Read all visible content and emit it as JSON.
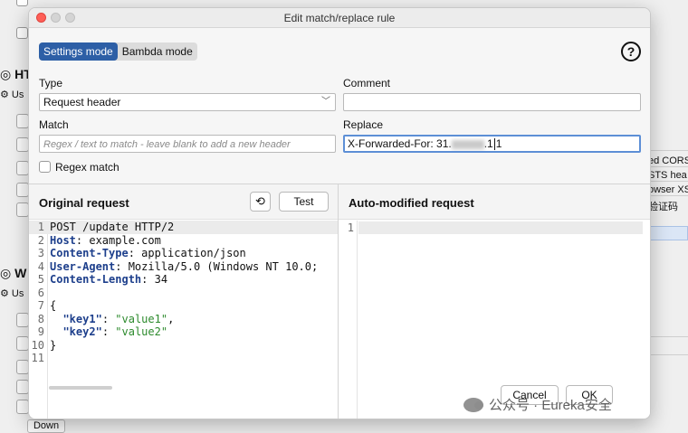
{
  "background": {
    "section1_title": "HT",
    "section1_sub": "Us",
    "section2_title": "W",
    "section2_sub": "Us",
    "right_texts": [
      "ed CORS",
      "STS hea",
      "owser XS",
      "验证码"
    ],
    "down_button": "Down"
  },
  "dialog": {
    "title": "Edit match/replace rule",
    "modes": [
      "Settings mode",
      "Bambda mode"
    ],
    "active_mode": "Settings mode",
    "help_symbol": "?",
    "type": {
      "label": "Type",
      "value": "Request header"
    },
    "comment": {
      "label": "Comment",
      "value": ""
    },
    "match": {
      "label": "Match",
      "placeholder": "Regex / text to match - leave blank to add a new header"
    },
    "replace": {
      "label": "Replace",
      "value_prefix": "X-Forwarded-For: 31.",
      "value_suffix": ".1"
    },
    "regex_match": {
      "label": "Regex match",
      "checked": false
    }
  },
  "original_request": {
    "title": "Original request",
    "test_label": "Test",
    "line_numbers": [
      "1",
      "2",
      "3",
      "4",
      "5",
      "6",
      "7",
      "8",
      "9",
      "10",
      "11"
    ],
    "request_line": "POST /update HTTP/2",
    "headers": [
      {
        "name": "Host",
        "value": ": example.com"
      },
      {
        "name": "Content-Type",
        "value": ": application/json"
      },
      {
        "name": "User-Agent",
        "value": ": Mozilla/5.0 (Windows NT 10.0;"
      },
      {
        "name": "Content-Length",
        "value": ": 34"
      }
    ],
    "body_open": "{",
    "body": [
      {
        "key": "\"key1\"",
        "sep": ": ",
        "value": "\"value1\"",
        "end": ","
      },
      {
        "key": "\"key2\"",
        "sep": ": ",
        "value": "\"value2\"",
        "end": ""
      }
    ],
    "body_close": "}"
  },
  "modified_request": {
    "title": "Auto-modified request",
    "line_numbers": [
      "1"
    ]
  },
  "footer": {
    "cancel": "Cancel",
    "ok": "OK",
    "watermark": "公众号 · Eureka安全"
  }
}
